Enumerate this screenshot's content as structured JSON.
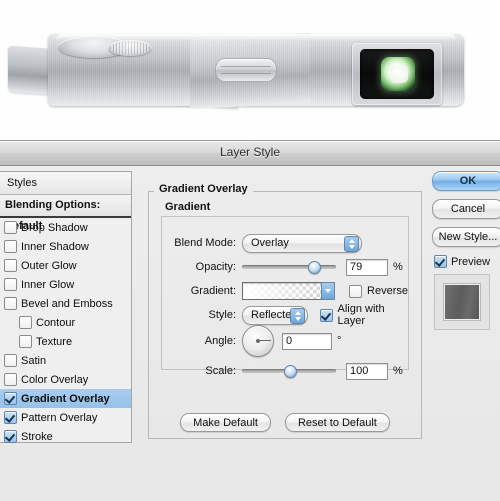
{
  "photo": {
    "subject": "brushed-metal-camera",
    "lens_glow_color": "#8fd07f"
  },
  "dialog": {
    "title": "Layer Style"
  },
  "sidebar": {
    "header": "Styles",
    "blending_options": "Blending Options: Default",
    "items": [
      {
        "label": "Drop Shadow",
        "checked": false,
        "selected": false,
        "sub": false
      },
      {
        "label": "Inner Shadow",
        "checked": false,
        "selected": false,
        "sub": false
      },
      {
        "label": "Outer Glow",
        "checked": false,
        "selected": false,
        "sub": false
      },
      {
        "label": "Inner Glow",
        "checked": false,
        "selected": false,
        "sub": false
      },
      {
        "label": "Bevel and Emboss",
        "checked": false,
        "selected": false,
        "sub": false
      },
      {
        "label": "Contour",
        "checked": false,
        "selected": false,
        "sub": true
      },
      {
        "label": "Texture",
        "checked": false,
        "selected": false,
        "sub": true
      },
      {
        "label": "Satin",
        "checked": false,
        "selected": false,
        "sub": false
      },
      {
        "label": "Color Overlay",
        "checked": false,
        "selected": false,
        "sub": false
      },
      {
        "label": "Gradient Overlay",
        "checked": true,
        "selected": true,
        "sub": false
      },
      {
        "label": "Pattern Overlay",
        "checked": true,
        "selected": false,
        "sub": false
      },
      {
        "label": "Stroke",
        "checked": true,
        "selected": false,
        "sub": false
      }
    ]
  },
  "main": {
    "group_title": "Gradient Overlay",
    "subgroup_title": "Gradient",
    "blend_mode": {
      "label": "Blend Mode:",
      "value": "Overlay"
    },
    "opacity": {
      "label": "Opacity:",
      "value": "79",
      "unit": "%",
      "percent": 79
    },
    "gradient": {
      "label": "Gradient:",
      "reverse_label": "Reverse",
      "reverse_checked": false
    },
    "style": {
      "label": "Style:",
      "value": "Reflected",
      "align_label": "Align with Layer",
      "align_checked": true
    },
    "angle": {
      "label": "Angle:",
      "value": "0",
      "unit": "°",
      "degrees": 0
    },
    "scale": {
      "label": "Scale:",
      "value": "100",
      "unit": "%",
      "percent": 50
    },
    "make_default": "Make Default",
    "reset_to_default": "Reset to Default"
  },
  "right": {
    "ok": "OK",
    "cancel": "Cancel",
    "new_style": "New Style...",
    "preview_label": "Preview",
    "preview_checked": true
  }
}
